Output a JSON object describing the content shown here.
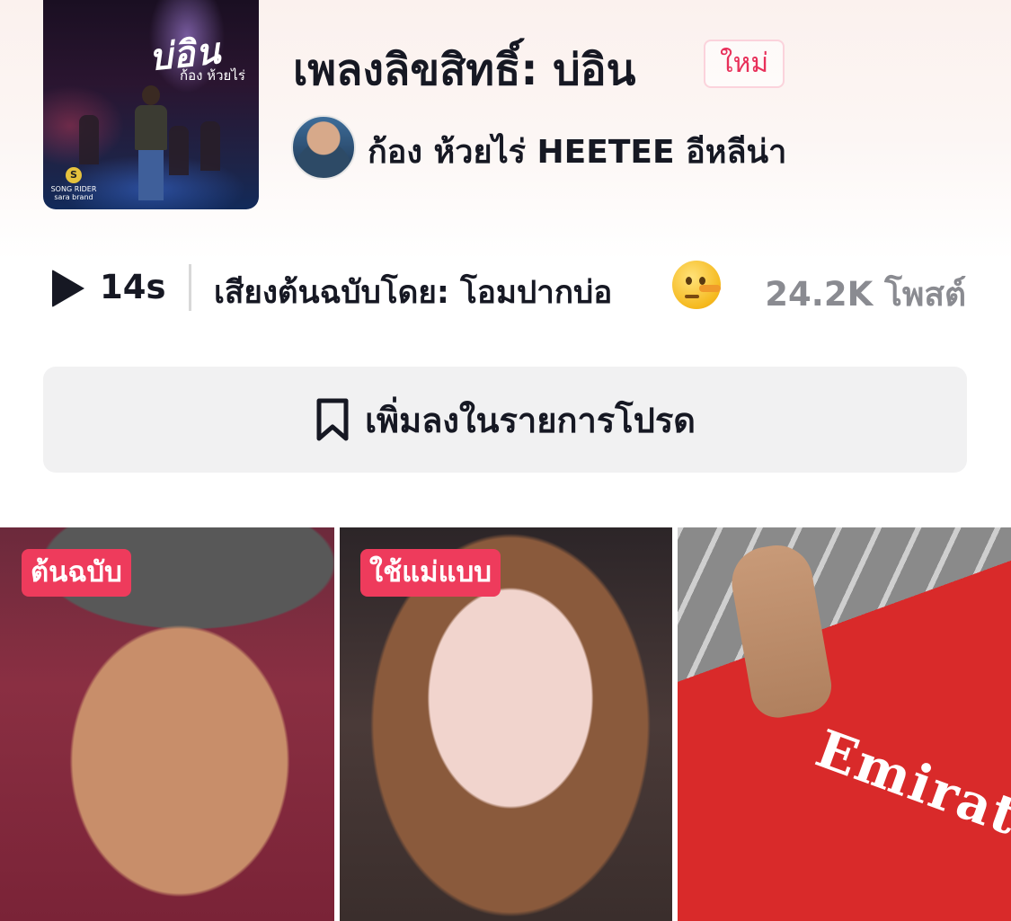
{
  "cover": {
    "art_title": "บ่อิน",
    "art_artist": "ก้อง ห้วยไร่",
    "label_line1": "SONG RIDER",
    "label_line2": "sara brand"
  },
  "song": {
    "title": "เพลงลิขสิทธิ์: บ่อิน",
    "badge": "ใหม่",
    "artists": "ก้อง ห้วยไร่ HEETEE อีหลีน่า"
  },
  "stats": {
    "duration": "14s",
    "source": "เสียงต้นฉบับโดย: โอมปากบ่อ",
    "emoji": "lying-face-emoji",
    "posts": "24.2K โพสต์"
  },
  "favorite": {
    "label": "เพิ่มลงในรายการโปรด",
    "icon": "bookmark-icon"
  },
  "videos": [
    {
      "tag": "ต้นฉบับ"
    },
    {
      "tag": "ใช้แม่แบบ"
    },
    {
      "tag": ""
    }
  ],
  "colors": {
    "accent": "#ee3b5c",
    "badge_text": "#e8305a",
    "muted": "#8a8b91",
    "button_bg": "#f1f1f2"
  }
}
